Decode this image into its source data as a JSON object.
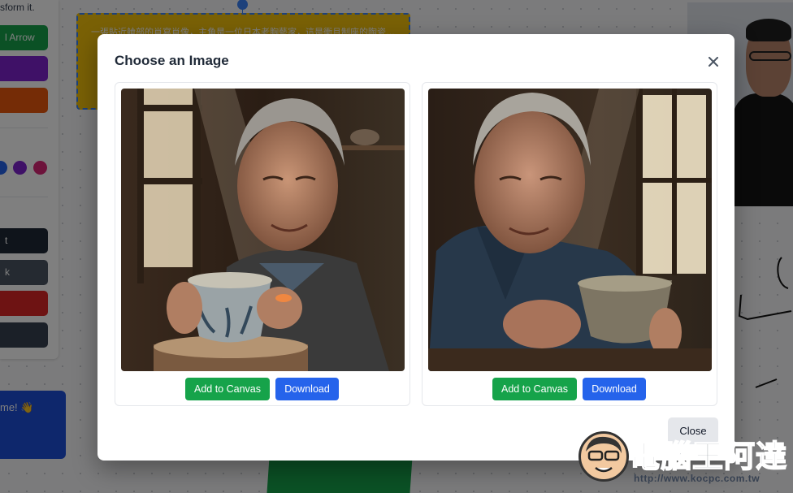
{
  "background": {
    "side_hint": "sform it.",
    "side_buttons": [
      {
        "label": "l Arrow",
        "color": "#16a34a"
      },
      {
        "label": "",
        "color": "#7e22ce"
      },
      {
        "label": "",
        "color": "#ea580c"
      },
      {
        "label": "t",
        "color": "#1f2937"
      },
      {
        "label": "k",
        "color": "#4b5563"
      },
      {
        "label": "",
        "color": "#dc2626"
      },
      {
        "label": "",
        "color": "#374151"
      }
    ],
    "color_dots": [
      "#2563eb",
      "#7e22ce",
      "#db2777"
    ],
    "note_text": "一張貼近艙部的肖寫肖像，主角是一位日本老胸藝家，這是衝且制座的陶瓷…",
    "welcome_text": "me! 👋",
    "note_color": "#f4c20d"
  },
  "modal": {
    "title": "Choose an Image",
    "cards": [
      {
        "add_label": "Add to Canvas",
        "download_label": "Download",
        "image_alt": "Elderly man holding a ceramic tea bowl by a sunlit window"
      },
      {
        "add_label": "Add to Canvas",
        "download_label": "Download",
        "image_alt": "Elderly man smiling at a ceramic cup in warm light"
      }
    ],
    "close_label": "Close"
  },
  "watermark": {
    "brand": "電腦王阿達",
    "url": "http://www.kocpc.com.tw"
  }
}
